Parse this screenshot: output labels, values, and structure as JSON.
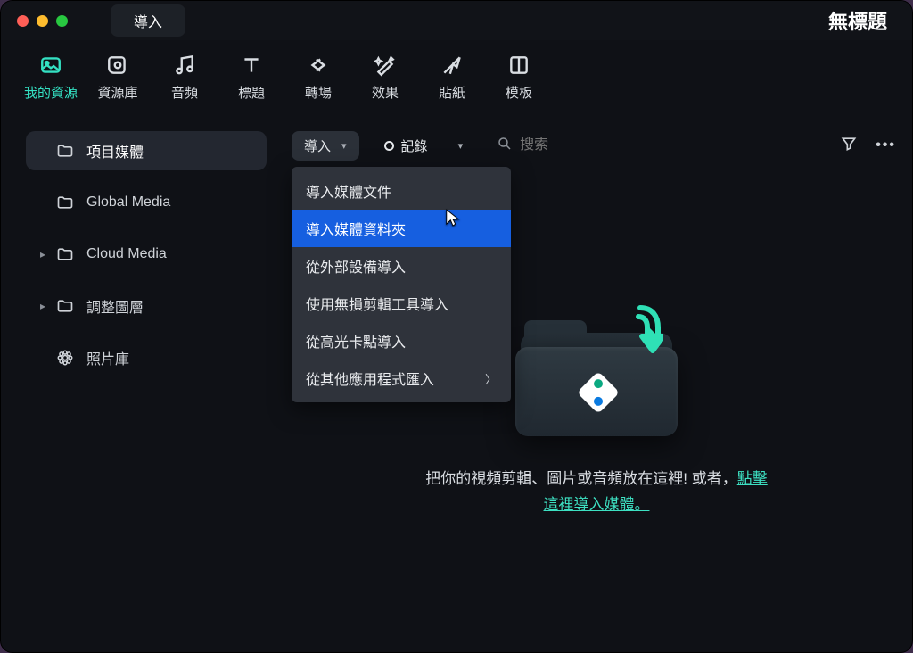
{
  "titlebar": {
    "pill_label": "導入",
    "project_name": "無標題"
  },
  "tabs": [
    {
      "id": "my-resources",
      "label": "我的資源"
    },
    {
      "id": "library",
      "label": "資源庫"
    },
    {
      "id": "audio",
      "label": "音頻"
    },
    {
      "id": "titles",
      "label": "標題"
    },
    {
      "id": "transitions",
      "label": "轉場"
    },
    {
      "id": "effects",
      "label": "效果"
    },
    {
      "id": "stickers",
      "label": "貼紙"
    },
    {
      "id": "templates",
      "label": "模板"
    }
  ],
  "active_tab": 0,
  "sidebar": {
    "items": [
      {
        "id": "project-media",
        "label": "項目媒體",
        "icon": "folder",
        "expandable": false,
        "selected": true
      },
      {
        "id": "global-media",
        "label": "Global Media",
        "icon": "folder",
        "expandable": false,
        "selected": false
      },
      {
        "id": "cloud-media",
        "label": "Cloud Media",
        "icon": "folder",
        "expandable": true,
        "selected": false
      },
      {
        "id": "adjustment",
        "label": "調整圖層",
        "icon": "folder",
        "expandable": true,
        "selected": false
      },
      {
        "id": "photos",
        "label": "照片庫",
        "icon": "photos",
        "expandable": false,
        "selected": false
      }
    ]
  },
  "toolbar": {
    "import_label": "導入",
    "record_label": "記錄",
    "search_placeholder": "搜索"
  },
  "import_menu": {
    "items": [
      {
        "label": "導入媒體文件",
        "submenu": false
      },
      {
        "label": "導入媒體資料夾",
        "submenu": false
      },
      {
        "label": "從外部設備導入",
        "submenu": false
      },
      {
        "label": "使用無損剪輯工具導入",
        "submenu": false
      },
      {
        "label": "從高光卡點導入",
        "submenu": false
      },
      {
        "label": "從其他應用程式匯入",
        "submenu": true
      }
    ],
    "hover_index": 1
  },
  "empty_state": {
    "line1": "把你的視頻剪輯、圖片或音頻放在這裡! 或者，",
    "link_a": "點擊",
    "link_b": "這裡導入媒體。"
  },
  "colors": {
    "bg": "#0f1116",
    "accent": "#34e0c2",
    "menu_hover": "#165fe0"
  }
}
